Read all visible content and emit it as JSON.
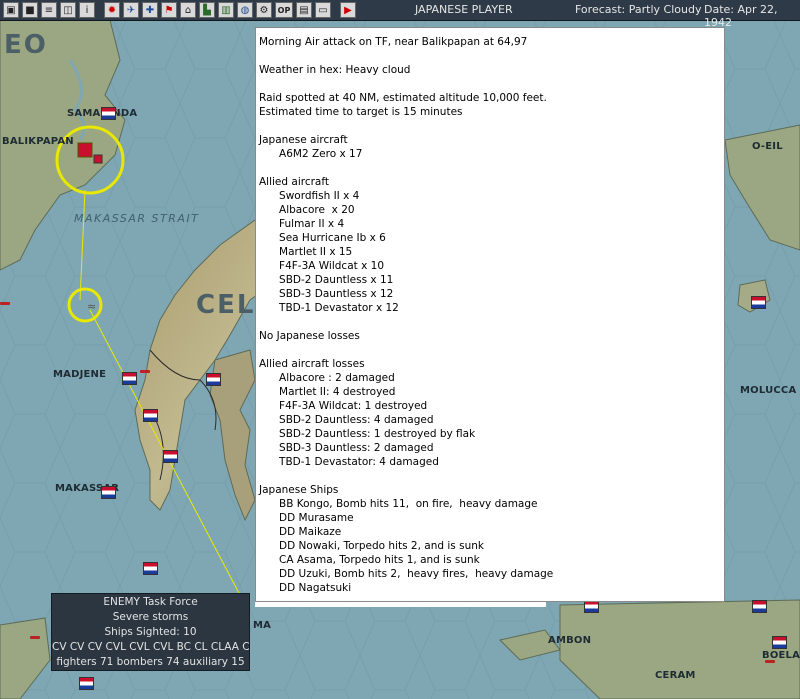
{
  "toolbar": {
    "icons": [
      "save-icon",
      "end-turn-icon",
      "report-icon",
      "info-icon",
      "japan-flag-icon",
      "aircraft-icon",
      "ship-icon",
      "flag-icon",
      "base-icon",
      "ground-icon",
      "chart-icon",
      "globe-icon",
      "gear-icon",
      "op-icon",
      "panel-icon",
      "play-icon"
    ],
    "op_label": "OP",
    "player_label": "JAPANESE PLAYER",
    "forecast_label": "Forecast: Partly Cloudy",
    "date_label": "Date: Apr 22, 1942"
  },
  "map": {
    "places": {
      "borneo_partial": "EO",
      "samarinda": "SAMARINDA",
      "balikpapan": "BALIKPAPAN",
      "makassar_strait": "MAKASSAR STRAIT",
      "celebes": "CELE",
      "madjene": "MADJENE",
      "makassar": "MAKASSAR",
      "ambon": "AMBON",
      "ceram": "CERAM",
      "boela": "BOELA",
      "moluccas": "MOLUCCA",
      "oeil": "O-EIL",
      "ma": "MA"
    }
  },
  "report": {
    "lines": [
      "Morning Air attack on TF, near Balikpapan at 64,97",
      "",
      "Weather in hex: Heavy cloud",
      "",
      "Raid spotted at 40 NM, estimated altitude 10,000 feet.",
      "Estimated time to target is 15 minutes",
      "",
      "Japanese aircraft",
      "      A6M2 Zero x 17",
      "",
      "Allied aircraft",
      "      Swordfish II x 4",
      "      Albacore  x 20",
      "      Fulmar II x 4",
      "      Sea Hurricane Ib x 6",
      "      Martlet II x 15",
      "      F4F-3A Wildcat x 10",
      "      SBD-2 Dauntless x 11",
      "      SBD-3 Dauntless x 12",
      "      TBD-1 Devastator x 12",
      "",
      "No Japanese losses",
      "",
      "Allied aircraft losses",
      "      Albacore : 2 damaged",
      "      Martlet II: 4 destroyed",
      "      F4F-3A Wildcat: 1 destroyed",
      "      SBD-2 Dauntless: 4 damaged",
      "      SBD-2 Dauntless: 1 destroyed by flak",
      "      SBD-3 Dauntless: 2 damaged",
      "      TBD-1 Devastator: 4 damaged",
      "",
      "Japanese Ships",
      "      BB Kongo, Bomb hits 11,  on fire,  heavy damage",
      "      DD Murasame",
      "      DD Maikaze",
      "      DD Nowaki, Torpedo hits 2, and is sunk",
      "      CA Asama, Torpedo hits 1, and is sunk",
      "      DD Uzuki, Bomb hits 2,  heavy fires,  heavy damage",
      "      DD Nagatsuki"
    ]
  },
  "enemy_tf": {
    "title": "ENEMY Task Force",
    "weather": "Severe storms",
    "sighted": "Ships Sighted: 10",
    "types": "CV CV CV CVL CVL CVL BC CL CLAA CLAA",
    "aircraft": "fighters 71  bombers 74  auxiliary 15"
  },
  "colors": {
    "sea": "#7fa7b3",
    "land": "#9aa782",
    "highlight_circle": "#e8e800",
    "toolbar": "#2e3a47"
  }
}
